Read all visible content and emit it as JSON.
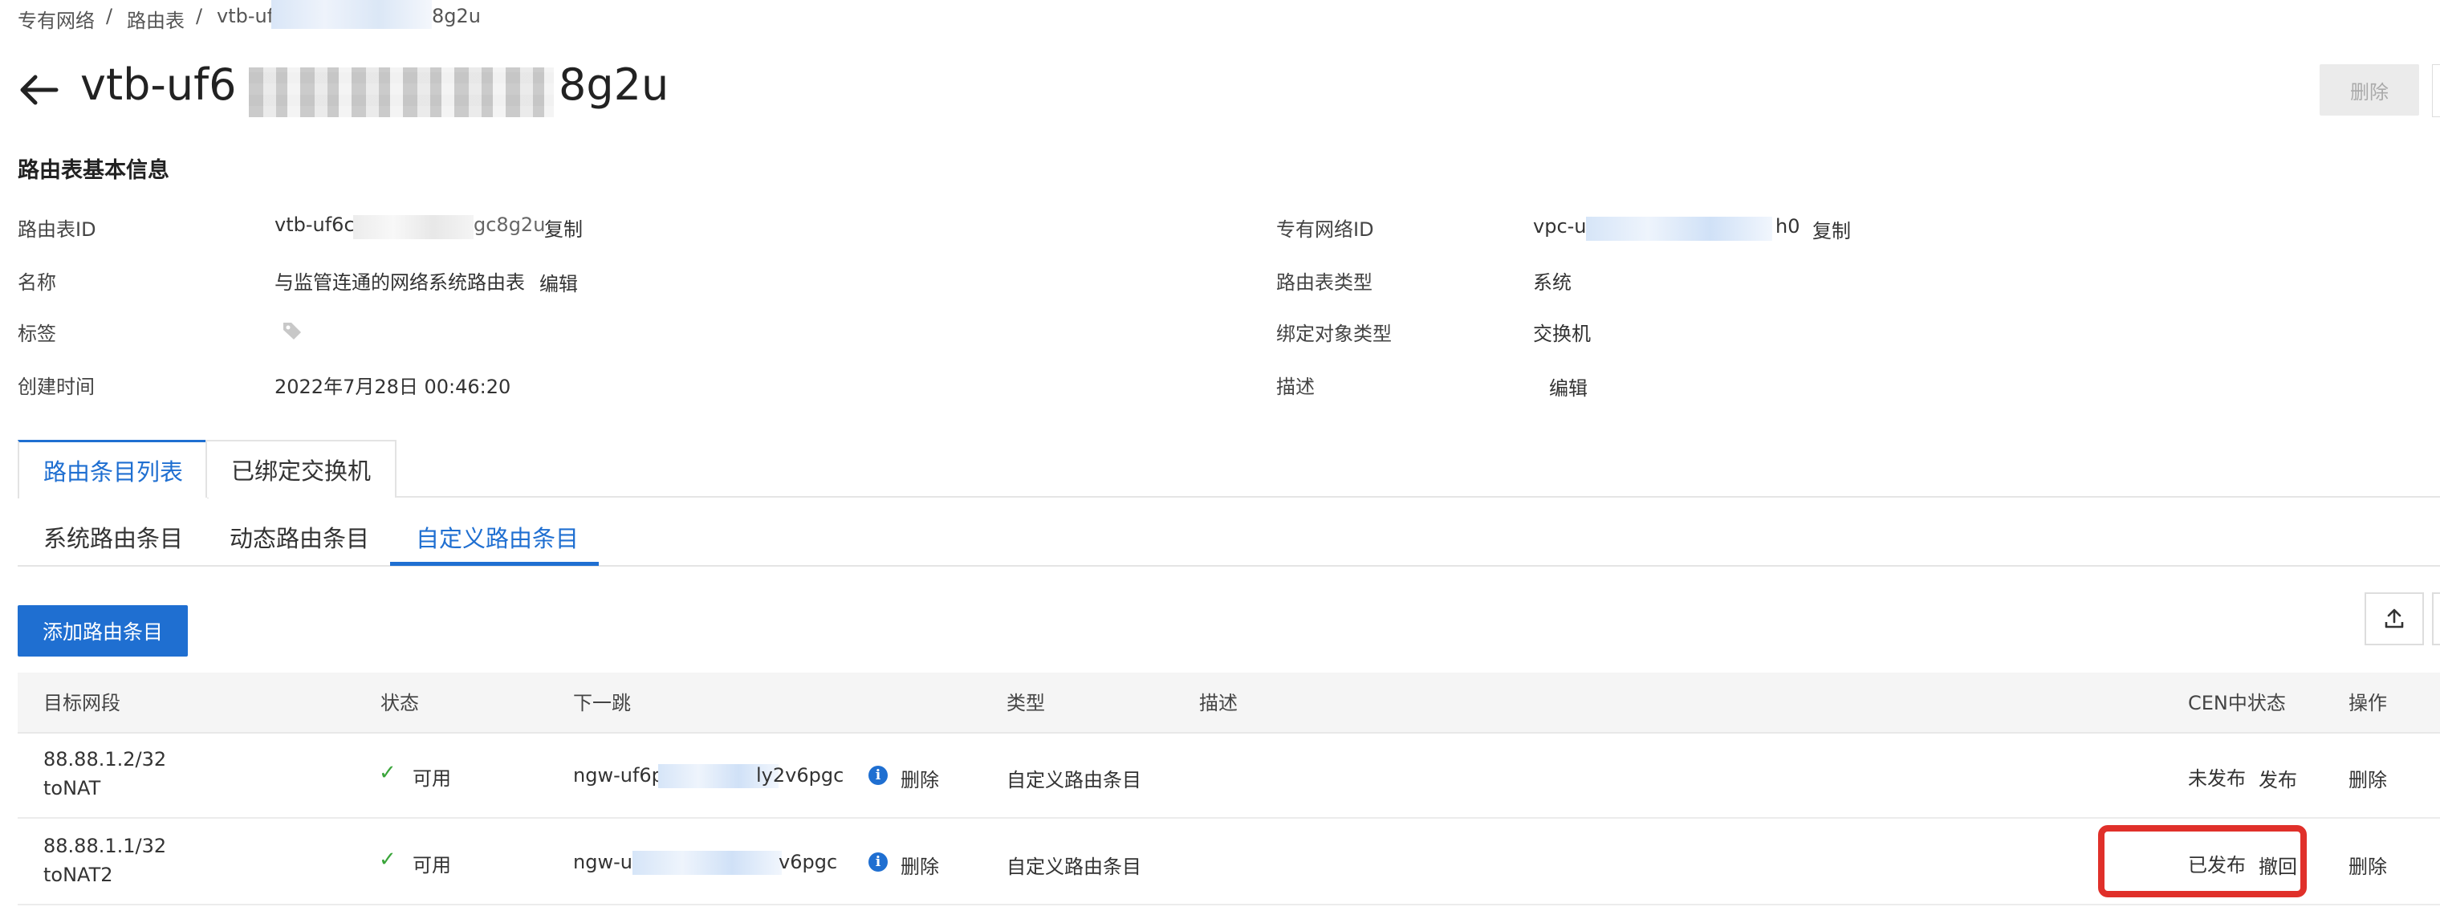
{
  "breadcrumb": {
    "item1": "专有网络",
    "item2": "路由表",
    "current": "vtb-uf",
    "current_end": "8g2u",
    "sep": "/"
  },
  "title": {
    "prefix": "vtb-uf6",
    "suffix": "8g2u"
  },
  "top_actions": {
    "delete_label": "删除"
  },
  "basic_info": {
    "heading": "路由表基本信息",
    "left": {
      "route_table_id_label": "路由表ID",
      "route_table_id_prefix": "vtb-uf6c",
      "route_table_id_suffix": "gc8g2u",
      "copy_label": "复制",
      "name_label": "名称",
      "name_value": "与监管连通的网络系统路由表",
      "edit_label": "编辑",
      "tag_label": "标签",
      "created_label": "创建时间",
      "created_value": "2022年7月28日 00:46:20"
    },
    "right": {
      "vpc_id_label": "专有网络ID",
      "vpc_id_prefix": "vpc-u",
      "vpc_id_suffix": "h0",
      "copy_label": "复制",
      "type_label": "路由表类型",
      "type_value": "系统",
      "bind_type_label": "绑定对象类型",
      "bind_type_value": "交换机",
      "desc_label": "描述",
      "edit_label": "编辑"
    }
  },
  "tabs": [
    {
      "label": "路由条目列表"
    },
    {
      "label": "已绑定交换机"
    }
  ],
  "subtabs": [
    {
      "label": "系统路由条目"
    },
    {
      "label": "动态路由条目"
    },
    {
      "label": "自定义路由条目"
    }
  ],
  "toolbar": {
    "add_label": "添加路由条目"
  },
  "table": {
    "headers": {
      "dest": "目标网段",
      "status": "状态",
      "next_hop": "下一跳",
      "type": "类型",
      "desc": "描述",
      "cen": "CEN中状态",
      "action": "操作"
    },
    "rows": [
      {
        "dest": "88.88.1.2/32",
        "name": "toNAT",
        "status": "可用",
        "hop_prefix": "ngw-uf6p",
        "hop_suffix": "ly2v6pgc",
        "hop_delete": "删除",
        "type": "自定义路由条目",
        "cen_status": "未发布",
        "cen_action": "发布",
        "action": "删除"
      },
      {
        "dest": "88.88.1.1/32",
        "name": "toNAT2",
        "status": "可用",
        "hop_prefix": "ngw-u",
        "hop_suffix": "v6pgc",
        "hop_delete": "删除",
        "type": "自定义路由条目",
        "cen_status": "已发布",
        "cen_action": "撤回",
        "action": "删除"
      }
    ]
  }
}
